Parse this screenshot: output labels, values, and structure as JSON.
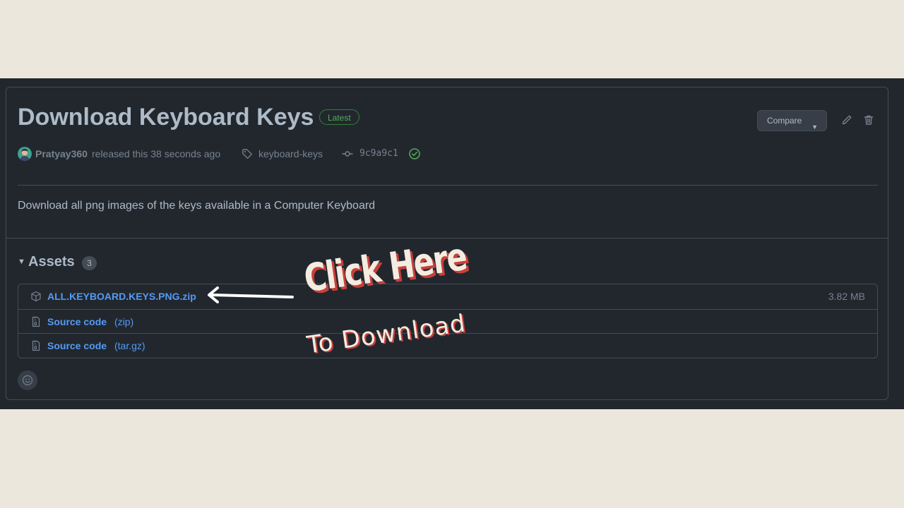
{
  "release": {
    "title": "Download Keyboard Keys",
    "badge": "Latest",
    "compare_label": "Compare",
    "author": "Pratyay360",
    "released_text": "released this 38 seconds ago",
    "tag": "keyboard-keys",
    "commit": "9c9a9c1",
    "description": "Download all png images of the keys available in a Computer Keyboard"
  },
  "assets": {
    "title": "Assets",
    "count": "3",
    "items": [
      {
        "name": "ALL.KEYBOARD.KEYS.PNG.zip",
        "suffix": "",
        "size": "3.82 MB",
        "icon": "package-icon"
      },
      {
        "name": "Source code",
        "suffix": "(zip)",
        "size": "",
        "icon": "file-zip-icon"
      },
      {
        "name": "Source code",
        "suffix": "(tar.gz)",
        "size": "",
        "icon": "file-zip-icon"
      }
    ]
  },
  "overlay": {
    "line1": "Click Here",
    "line2": "To Download"
  },
  "colors": {
    "background": "#ece7dc",
    "panel": "#22272e",
    "link": "#539bf5",
    "badge_green": "#57ab5a",
    "overlay_text": "#f3ece0",
    "overlay_shadow": "#c7403b"
  }
}
